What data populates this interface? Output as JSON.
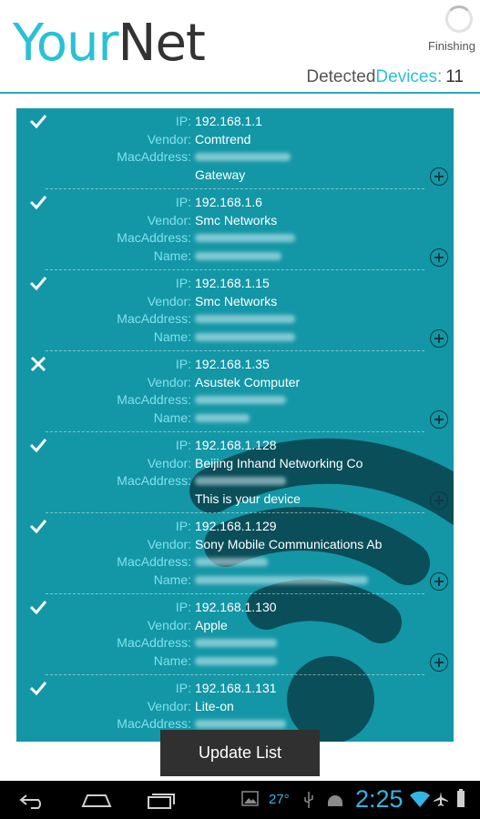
{
  "app": {
    "title_part1": "Your",
    "title_part2": "Net",
    "status": "Finishing"
  },
  "summary": {
    "label_part1": "Detected",
    "label_part2": "Devices:",
    "count": "11"
  },
  "labels": {
    "ip": "IP:",
    "vendor": "Vendor:",
    "mac": "MacAddress:",
    "name": "Name:"
  },
  "devices": [
    {
      "ip": "192.168.1.1",
      "vendor": "Comtrend",
      "note": "Gateway",
      "icon": "check-icon"
    },
    {
      "ip": "192.168.1.6",
      "vendor": "Smc Networks",
      "note": "",
      "icon": "check-icon"
    },
    {
      "ip": "192.168.1.15",
      "vendor": "Smc Networks",
      "note": "",
      "icon": "check-icon"
    },
    {
      "ip": "192.168.1.35",
      "vendor": "Asustek Computer",
      "note": "",
      "icon": "x-icon"
    },
    {
      "ip": "192.168.1.128",
      "vendor": "Beijing Inhand Networking  Co",
      "note": "This is your device",
      "icon": "check-icon"
    },
    {
      "ip": "192.168.1.129",
      "vendor": "Sony Mobile Communications Ab",
      "note": "",
      "icon": "check-icon"
    },
    {
      "ip": "192.168.1.130",
      "vendor": "Apple",
      "note": "",
      "icon": "check-icon"
    },
    {
      "ip": "192.168.1.131",
      "vendor": "Lite-on",
      "note": "",
      "icon": "check-icon"
    }
  ],
  "toast": {
    "label": "Update List"
  },
  "statusbar": {
    "temperature": "27°",
    "time": "2:25"
  },
  "colors": {
    "accent": "#29c1d6",
    "list_bg": "#1397a6",
    "label": "#7fe0ee"
  }
}
